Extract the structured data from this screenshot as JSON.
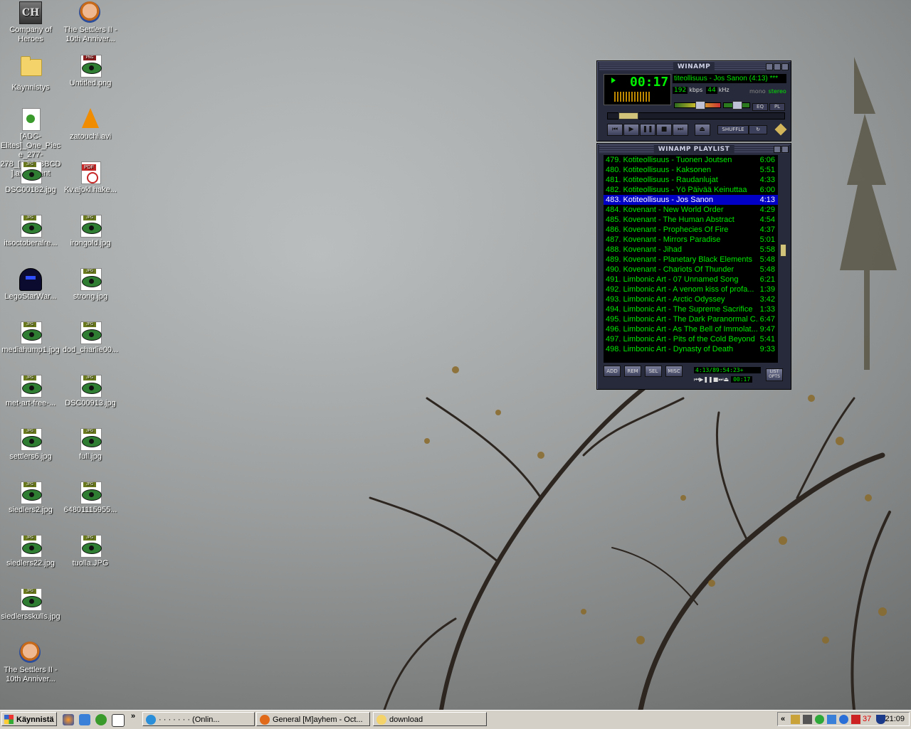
{
  "desktop": {
    "icons": [
      {
        "label": "Company of Heroes",
        "kind": "coh"
      },
      {
        "label": "The Settlers II - 10th Anniver...",
        "kind": "settler"
      },
      {
        "label": "Käynnistys",
        "kind": "folder"
      },
      {
        "label": "Untitled.png",
        "kind": "png"
      },
      {
        "label": "[ADC-Elites]_One_Piece_277-278_[FB3FBBCD].avi.torrent",
        "kind": "torrent"
      },
      {
        "label": "zatouchi.avi",
        "kind": "vlc"
      },
      {
        "label": "DSC00182.jpg",
        "kind": "jpg"
      },
      {
        "label": "Kv.ajokl.hake...",
        "kind": "pdf"
      },
      {
        "label": "itsoctoberalre...",
        "kind": "jpg"
      },
      {
        "label": "irongold.jpg",
        "kind": "jpg"
      },
      {
        "label": "LegoStarWar...",
        "kind": "lego"
      },
      {
        "label": "strong.jpg",
        "kind": "jpg"
      },
      {
        "label": "mediahump1.jpg",
        "kind": "jpg"
      },
      {
        "label": "dod_charlie00...",
        "kind": "jpg"
      },
      {
        "label": "met-art-free-...",
        "kind": "jpg"
      },
      {
        "label": "DSC00913.jpg",
        "kind": "jpg"
      },
      {
        "label": "settlers6.jpg",
        "kind": "jpg"
      },
      {
        "label": "full.jpg",
        "kind": "jpg"
      },
      {
        "label": "siedlers2.jpg",
        "kind": "jpg"
      },
      {
        "label": "64801115955...",
        "kind": "jpg"
      },
      {
        "label": "siedlers22.jpg",
        "kind": "jpg"
      },
      {
        "label": "tuolla.JPG",
        "kind": "jpg"
      },
      {
        "label": "siedlersskulls.jpg",
        "kind": "jpg"
      },
      {
        "label": "The Settlers II - 10th Anniver...",
        "kind": "settler"
      }
    ],
    "tags": {
      "jpg": "JPG",
      "png": "PNG",
      "pdf": "PDF",
      "coh": "CH"
    }
  },
  "winamp": {
    "title": "WINAMP",
    "time": "00:17",
    "song": "titeollisuus - Jos Sanon (4:13) ***",
    "kbps": "192",
    "kbps_label": "kbps",
    "khz": "44",
    "khz_label": "kHz",
    "mono": "mono",
    "stereo": "stereo",
    "eq": "EQ",
    "pl": "PL",
    "shuffle": "SHUFFLE",
    "repeat": "↻",
    "volume": 0.55,
    "balance": 0.5,
    "seek": 0.067
  },
  "playlist": {
    "title": "WINAMP PLAYLIST",
    "selected_index": 4,
    "items": [
      {
        "title": "479. Kotiteollisuus - Tuonen Joutsen",
        "dur": "6:06"
      },
      {
        "title": "480. Kotiteollisuus - Kaksonen",
        "dur": "5:51"
      },
      {
        "title": "481. Kotiteollisuus - Raudanlujat",
        "dur": "4:33"
      },
      {
        "title": "482. Kotiteollisuus - Yö Päivää Keinuttaa",
        "dur": "6:00"
      },
      {
        "title": "483. Kotiteollisuus - Jos Sanon",
        "dur": "4:13"
      },
      {
        "title": "484. Kovenant - New World Order",
        "dur": "4:29"
      },
      {
        "title": "485. Kovenant - The Human Abstract",
        "dur": "4:54"
      },
      {
        "title": "486. Kovenant - Prophecies Of Fire",
        "dur": "4:37"
      },
      {
        "title": "487. Kovenant - Mirrors Paradise",
        "dur": "5:01"
      },
      {
        "title": "488. Kovenant - Jihad",
        "dur": "5:58"
      },
      {
        "title": "489. Kovenant - Planetary Black Elements",
        "dur": "5:48"
      },
      {
        "title": "490. Kovenant - Chariots Of Thunder",
        "dur": "5:48"
      },
      {
        "title": "491. Limbonic Art - 07 Unnamed Song",
        "dur": "6:21"
      },
      {
        "title": "492. Limbonic Art - A venom kiss of profa...",
        "dur": "1:39"
      },
      {
        "title": "493. Limbonic Art - Arctic Odyssey",
        "dur": "3:42"
      },
      {
        "title": "494. Limbonic Art - The Supreme Sacrifice",
        "dur": "1:33"
      },
      {
        "title": "495. Limbonic Art - The Dark Paranormal C...",
        "dur": "6:47"
      },
      {
        "title": "496. Limbonic Art - As The Bell of Immolat...",
        "dur": "9:47"
      },
      {
        "title": "497. Limbonic Art - Pits of the Cold Beyond",
        "dur": "5:41"
      },
      {
        "title": "498. Limbonic Art - Dynasty of Death",
        "dur": "9:33"
      }
    ],
    "btn_add": "ADD",
    "btn_rem": "REM",
    "btn_sel": "SEL",
    "btn_misc": "MISC",
    "total": "4:13/89:54:23+",
    "mini_time": "00:17",
    "list_opts": "LIST OPTS"
  },
  "taskbar": {
    "start": "Käynnistä",
    "more": "»",
    "tasks": [
      {
        "label": "· · · · · · · (Onlin...",
        "color": "#2a8fd8"
      },
      {
        "label": "General [M]ayhem - Oct...",
        "color": "#e06a1a"
      },
      {
        "label": "download",
        "color": "#f3d36a"
      }
    ],
    "tray_arrow": "«",
    "tray_num": "37",
    "clock": "21:09"
  }
}
